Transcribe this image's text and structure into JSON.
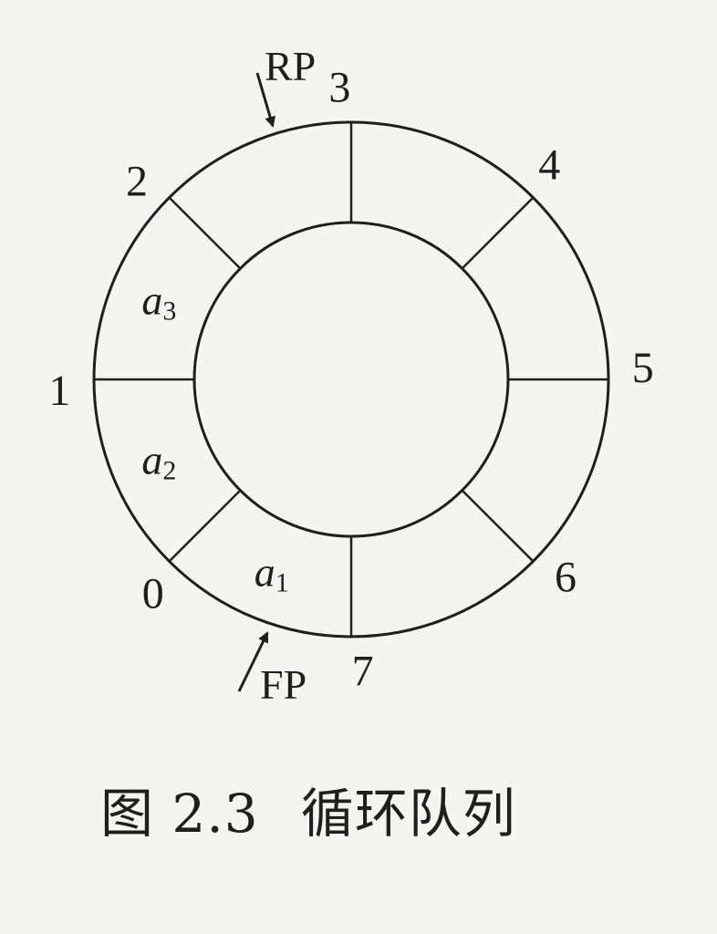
{
  "diagram": {
    "slots": [
      {
        "index": "0",
        "element": {
          "name": "a",
          "sub": "1"
        }
      },
      {
        "index": "1",
        "element": {
          "name": "a",
          "sub": "2"
        }
      },
      {
        "index": "2",
        "element": {
          "name": "a",
          "sub": "3"
        }
      },
      {
        "index": "3",
        "element": null
      },
      {
        "index": "4",
        "element": null
      },
      {
        "index": "5",
        "element": null
      },
      {
        "index": "6",
        "element": null
      },
      {
        "index": "7",
        "element": null
      }
    ],
    "pointers": {
      "rear": "RP",
      "front": "FP"
    }
  },
  "caption": {
    "number": "图 2.3",
    "title": "循环队列"
  }
}
